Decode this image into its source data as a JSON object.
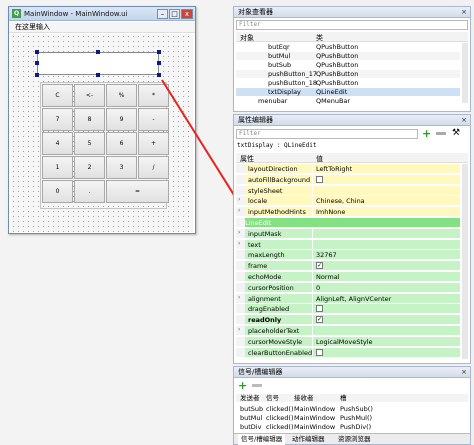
{
  "form": {
    "title": "MainWindow - MainWindow.ui",
    "menu_placeholder": "在这里输入",
    "buttons": [
      [
        "C",
        "<-",
        "%",
        "*"
      ],
      [
        "7",
        "8",
        "9",
        "-"
      ],
      [
        "4",
        "5",
        "6",
        "+"
      ],
      [
        "1",
        "2",
        "3",
        "/"
      ],
      [
        "0",
        ".",
        "=",
        ""
      ]
    ]
  },
  "object_inspector": {
    "title": "对象查看器",
    "filter": "Filter",
    "col_object": "对象",
    "col_class": "类",
    "rows": [
      {
        "obj": "butEqr",
        "cls": "QPushButton"
      },
      {
        "obj": "butMul",
        "cls": "QPushButton"
      },
      {
        "obj": "butSub",
        "cls": "QPushButton"
      },
      {
        "obj": "pushButton_17",
        "cls": "QPushButton"
      },
      {
        "obj": "pushButton_18",
        "cls": "QPushButton"
      },
      {
        "obj": "txtDisplay",
        "cls": "QLineEdit"
      },
      {
        "obj": "menubar",
        "cls": "QMenuBar"
      }
    ]
  },
  "property_editor": {
    "title": "属性编辑器",
    "filter": "Filter",
    "context": "txtDisplay : QLineEdit",
    "col_prop": "属性",
    "col_value": "值",
    "rows": [
      {
        "name": "layoutDirection",
        "value": "LeftToRight",
        "bg": "yel"
      },
      {
        "name": "autoFillBackground",
        "value": "",
        "bg": "yel",
        "check": true
      },
      {
        "name": "styleSheet",
        "value": "",
        "bg": "yel"
      },
      {
        "name": "locale",
        "value": "Chinese, China",
        "bg": "yel",
        "expand": true
      },
      {
        "name": "inputMethodHints",
        "value": "ImhNone",
        "bg": "yel",
        "expand": true
      },
      {
        "name": "QLineEdit",
        "value": "",
        "bg": "grnd",
        "section": true
      },
      {
        "name": "inputMask",
        "value": "",
        "bg": "grn",
        "expand": true
      },
      {
        "name": "text",
        "value": "",
        "bg": "grn",
        "expand": true
      },
      {
        "name": "maxLength",
        "value": "32767",
        "bg": "grn"
      },
      {
        "name": "frame",
        "value": "",
        "bg": "grn",
        "check": true,
        "checked": true
      },
      {
        "name": "echoMode",
        "value": "Normal",
        "bg": "grn"
      },
      {
        "name": "cursorPosition",
        "value": "0",
        "bg": "grn"
      },
      {
        "name": "alignment",
        "value": "AlignLeft, AlignVCenter",
        "bg": "grn",
        "expand": true
      },
      {
        "name": "dragEnabled",
        "value": "",
        "bg": "grn",
        "check": true
      },
      {
        "name": "readOnly",
        "value": "",
        "bg": "grn",
        "check": true,
        "checked": true,
        "bold": true
      },
      {
        "name": "placeholderText",
        "value": "",
        "bg": "grn",
        "expand": true
      },
      {
        "name": "cursorMoveStyle",
        "value": "LogicalMoveStyle",
        "bg": "grn"
      },
      {
        "name": "clearButtonEnabled",
        "value": "",
        "bg": "grn",
        "check": true
      }
    ]
  },
  "signal_editor": {
    "title": "信号/槽编辑器",
    "cols": [
      "发送者",
      "信号",
      "接收者",
      "槽"
    ],
    "rows": [
      [
        "butSub",
        "clicked()",
        "MainWindow",
        "PushSub()"
      ],
      [
        "butMul",
        "clicked()",
        "MainWindow",
        "PushMul()"
      ],
      [
        "butDiv",
        "clicked()",
        "MainWindow",
        "PushDiv()"
      ]
    ],
    "tabs": [
      "信号/槽编辑器",
      "动作编辑器",
      "资源浏览器"
    ]
  }
}
